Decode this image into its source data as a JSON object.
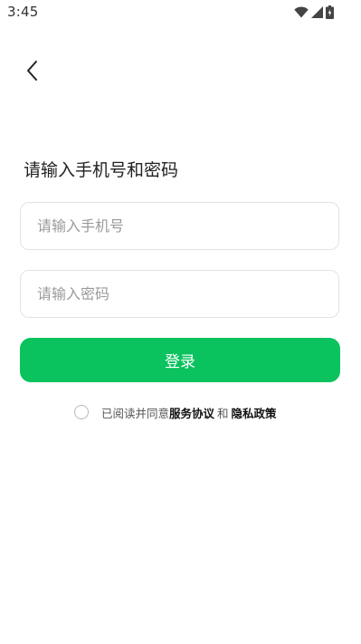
{
  "status_bar": {
    "time": "3:45",
    "icons": [
      "wifi-icon",
      "signal-icon",
      "battery-icon"
    ]
  },
  "header": {
    "back_icon": "chevron-left-icon"
  },
  "main": {
    "title": "请输入手机号和密码",
    "phone_input": {
      "placeholder": "请输入手机号",
      "value": ""
    },
    "password_input": {
      "placeholder": "请输入密码",
      "value": ""
    },
    "login_label": "登录",
    "agreement": {
      "checked": false,
      "prefix": "已阅读并同意",
      "service_link": "服务协议",
      "conjunction": "和",
      "privacy_link": "隐私政策"
    }
  },
  "colors": {
    "accent": "#0ac25e",
    "input_border": "#e2e2e2",
    "placeholder": "#9a9a9a",
    "text": "#222222"
  }
}
